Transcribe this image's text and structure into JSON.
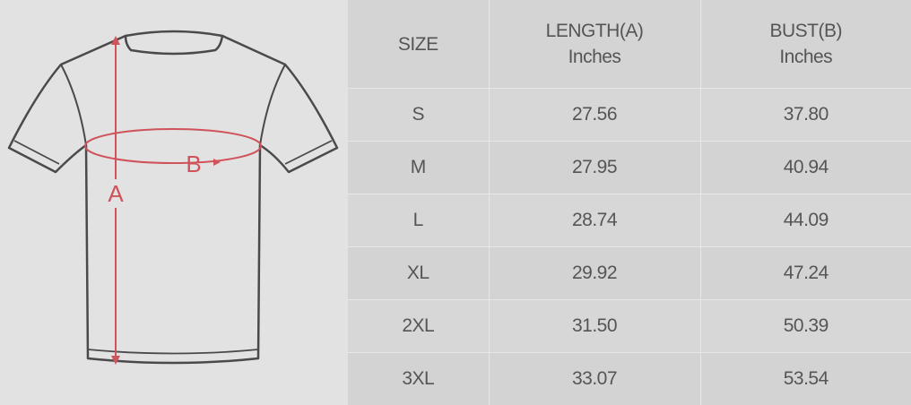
{
  "figure": {
    "length_marker": "A",
    "bust_marker": "B",
    "accent_color": "#d0525a",
    "outline_color": "#4a4a4a"
  },
  "table": {
    "headers": [
      {
        "line1": "SIZE",
        "line2": ""
      },
      {
        "line1": "LENGTH(A)",
        "line2": "Inches"
      },
      {
        "line1": "BUST(B)",
        "line2": "Inches"
      }
    ],
    "rows": [
      {
        "size": "S",
        "length": "27.56",
        "bust": "37.80"
      },
      {
        "size": "M",
        "length": "27.95",
        "bust": "40.94"
      },
      {
        "size": "L",
        "length": "28.74",
        "bust": "44.09"
      },
      {
        "size": "XL",
        "length": "29.92",
        "bust": "47.24"
      },
      {
        "size": "2XL",
        "length": "31.50",
        "bust": "50.39"
      },
      {
        "size": "3XL",
        "length": "33.07",
        "bust": "53.54"
      }
    ]
  }
}
